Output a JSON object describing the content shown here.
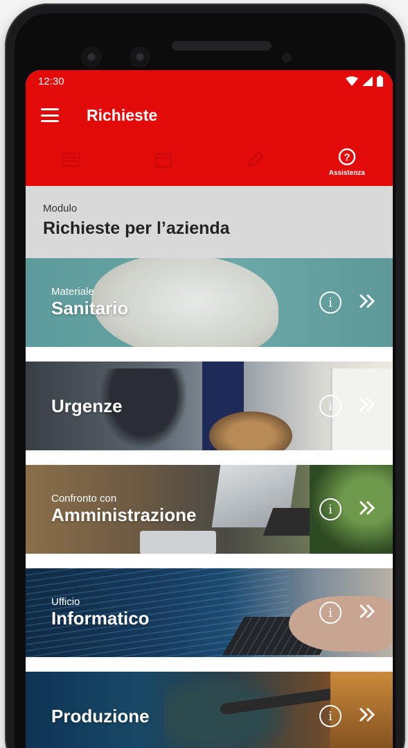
{
  "statusbar": {
    "time": "12:30"
  },
  "appbar": {
    "title": "Richieste"
  },
  "tabs": [
    {
      "label": "",
      "icon": "news-icon",
      "active": false
    },
    {
      "label": "",
      "icon": "calendar-icon",
      "active": false
    },
    {
      "label": "",
      "icon": "pencil-icon",
      "active": false
    },
    {
      "label": "Assistenza",
      "icon": "help-circle-icon",
      "active": true
    }
  ],
  "module": {
    "label": "Modulo",
    "title": "Richieste per l’azienda"
  },
  "cards": [
    {
      "pre": "Materiale",
      "main": "Sanitario"
    },
    {
      "pre": "",
      "main": "Urgenze"
    },
    {
      "pre": "Confronto con",
      "main": "Amministrazione"
    },
    {
      "pre": "Ufficio",
      "main": "Informatico"
    },
    {
      "pre": "",
      "main": "Produzione"
    }
  ],
  "colors": {
    "brand_red": "#e30a0a",
    "module_bg": "#d9d9da"
  }
}
